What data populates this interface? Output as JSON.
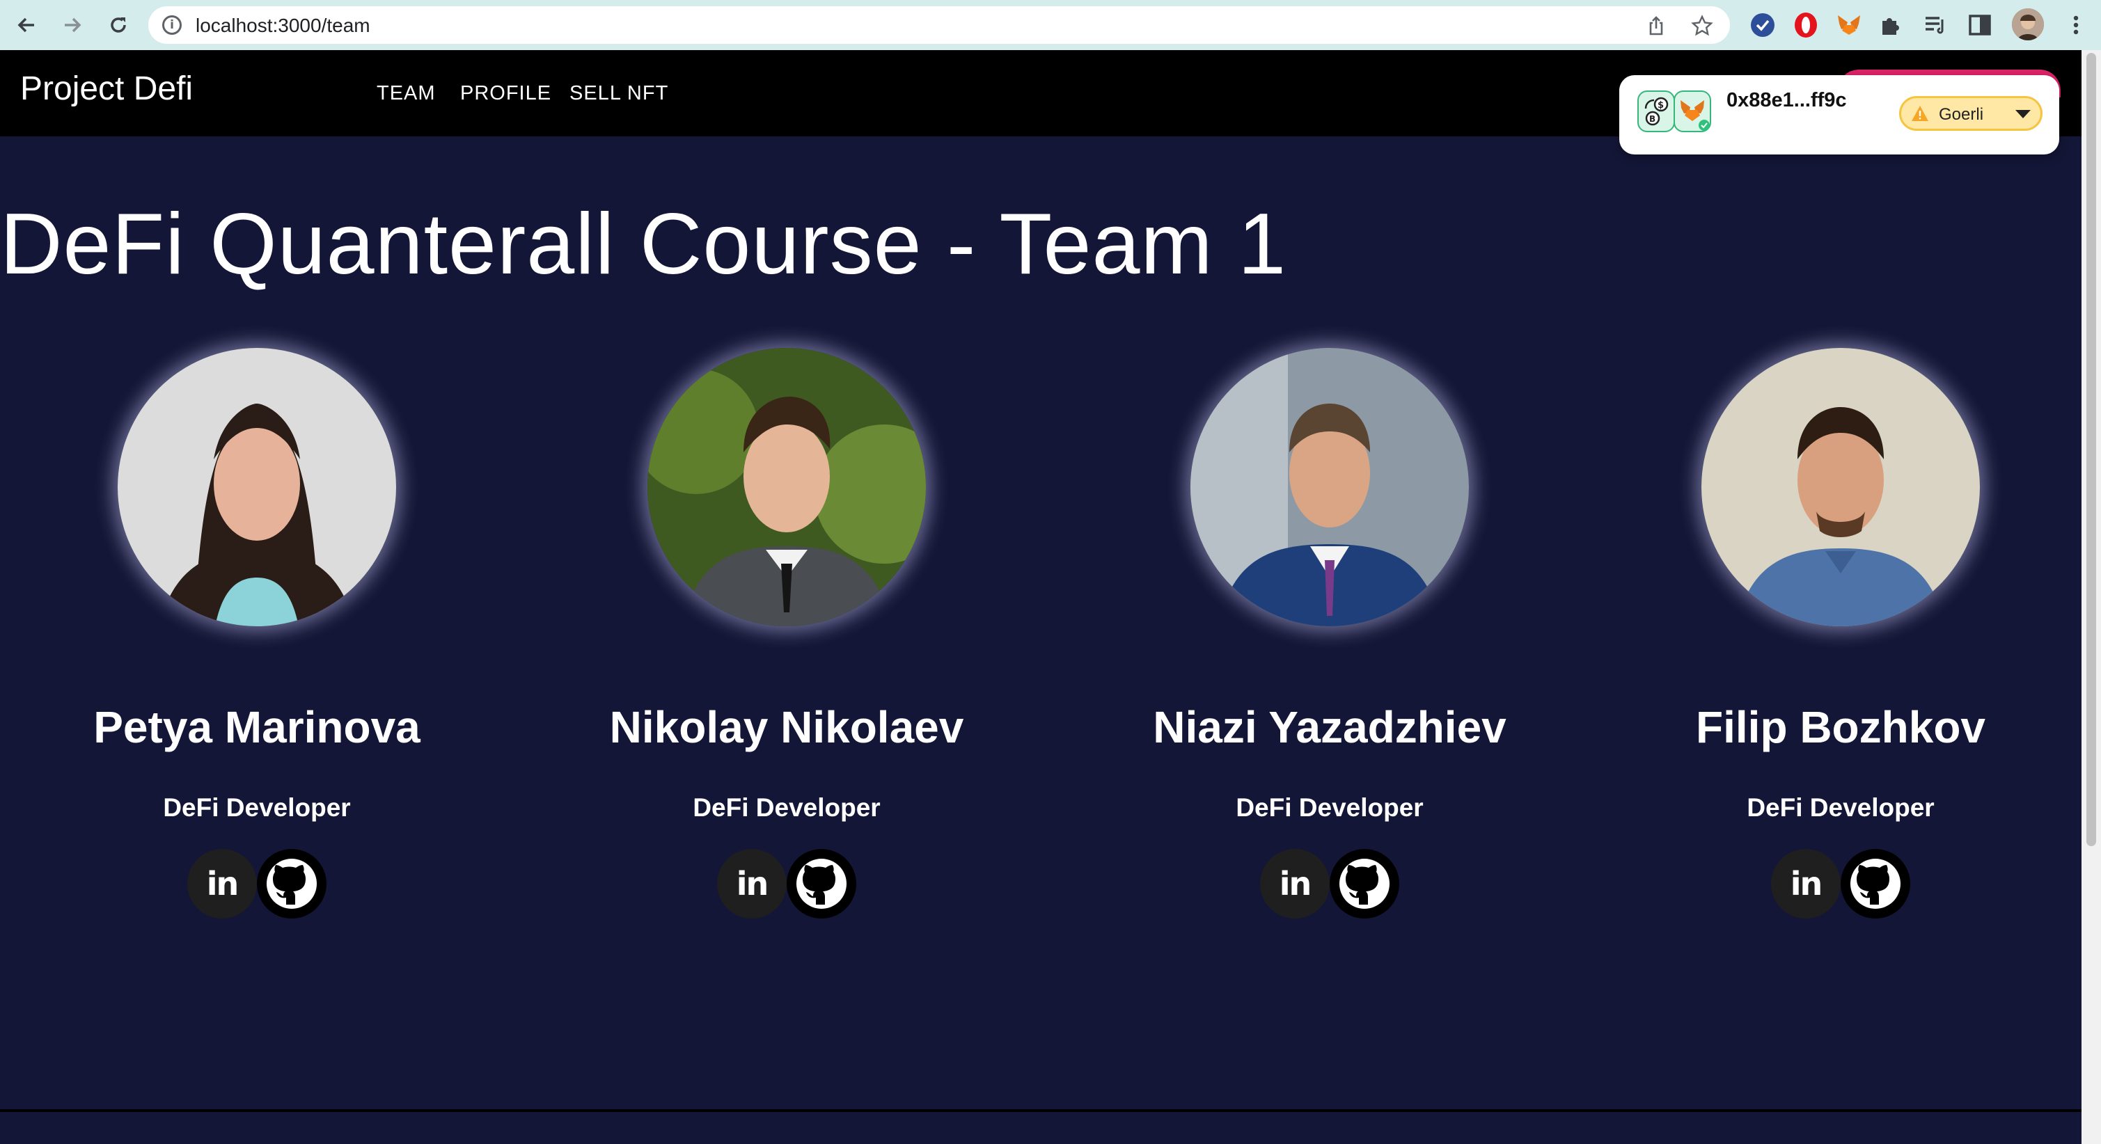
{
  "browser": {
    "url": "localhost:3000/team",
    "icons": [
      "back-icon",
      "forward-icon",
      "reload-icon",
      "site-info-icon",
      "share-icon",
      "bookmark-star-icon",
      "extension-check-icon",
      "extension-opera-icon",
      "extension-metamask-icon",
      "extensions-puzzle-icon",
      "reading-list-icon",
      "side-panel-icon",
      "profile-avatar",
      "more-menu-icon"
    ]
  },
  "header": {
    "brand": "Project Defi",
    "nav": [
      "TEAM",
      "PROFILE",
      "SELL NFT"
    ]
  },
  "wallet": {
    "address": "0x88e1...ff9c",
    "network": "Goerli",
    "network_status_color": "#f5a623"
  },
  "main": {
    "title": "DeFi Quanterall Course - Team 1"
  },
  "team": [
    {
      "name": "Petya Marinova",
      "role": "DeFi Developer"
    },
    {
      "name": "Nikolay Nikolaev",
      "role": "DeFi Developer"
    },
    {
      "name": "Niazi Yazadzhiev",
      "role": "DeFi Developer"
    },
    {
      "name": "Filip Bozhkov",
      "role": "DeFi Developer"
    }
  ],
  "socials": {
    "linkedin_label": "in"
  },
  "colors": {
    "page_background": "#141637",
    "header_background": "#000000",
    "browser_chrome": "#d4ecec",
    "accent_pink": "#e0246a"
  }
}
